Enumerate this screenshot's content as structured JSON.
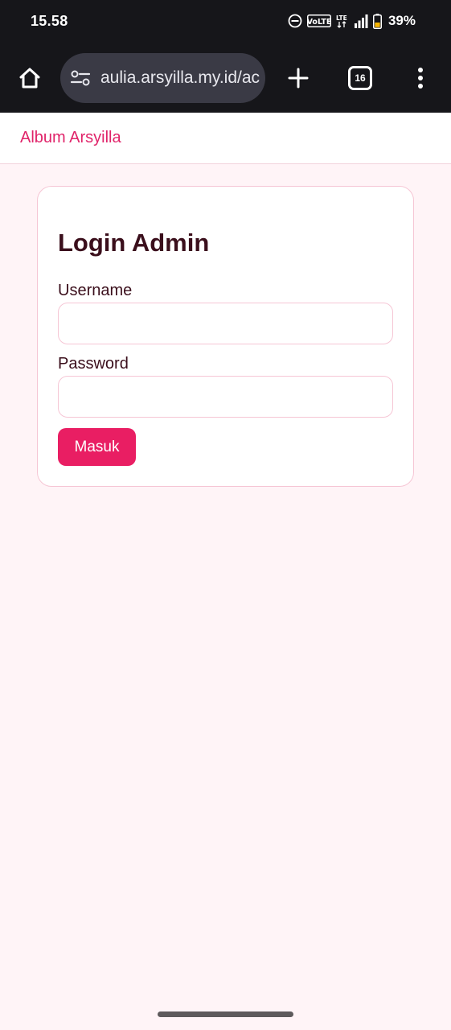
{
  "status_bar": {
    "time": "15.58",
    "network_badge": "VoLTE",
    "network_type": "LTE",
    "battery_percent": "39%",
    "icons": [
      "do-not-disturb-icon",
      "volte-icon",
      "lte-icon",
      "signal-icon",
      "battery-icon"
    ]
  },
  "browser": {
    "url": "aulia.arsyilla.my.id/ac",
    "tab_count": "16",
    "icons": [
      "home-icon",
      "site-settings-icon",
      "new-tab-icon",
      "tab-switcher-icon",
      "more-menu-icon"
    ]
  },
  "site": {
    "brand": "Album Arsyilla"
  },
  "login": {
    "title": "Login Admin",
    "username_label": "Username",
    "username_value": "",
    "password_label": "Password",
    "password_value": "",
    "submit_label": "Masuk"
  },
  "colors": {
    "accent": "#e91e63",
    "brand_text": "#e0246a",
    "page_background": "#fff4f7",
    "card_border": "#f6c6d5",
    "heading_text": "#3b0f1c",
    "browser_chrome": "#16161a"
  }
}
